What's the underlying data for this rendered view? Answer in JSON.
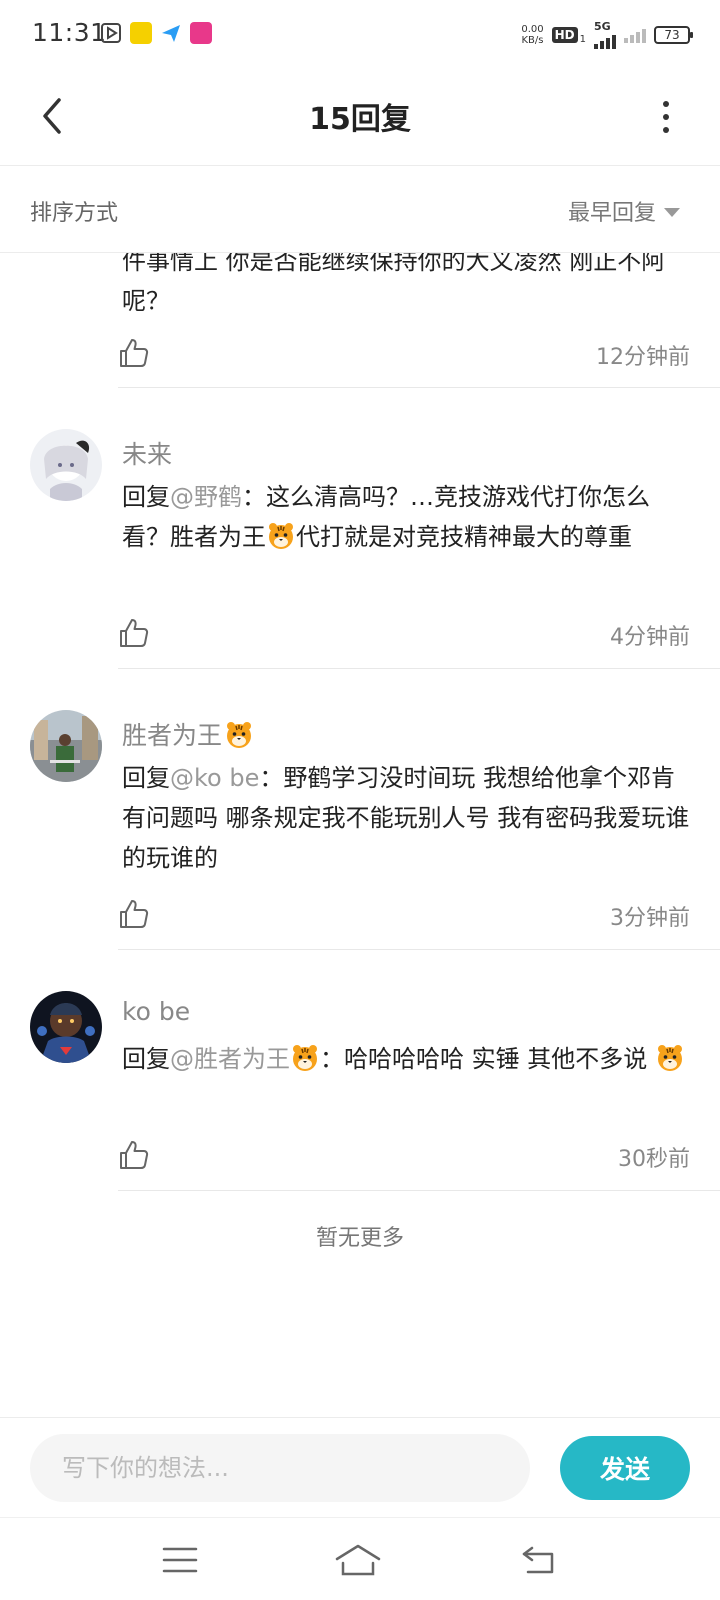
{
  "status_bar": {
    "time": "11:31",
    "net_speed_value": "0.00",
    "net_speed_unit": "KB/s",
    "hd_label": "HD",
    "hd_sub": "1",
    "network": "5G",
    "battery": "73"
  },
  "header": {
    "title": "15回复"
  },
  "sort": {
    "label": "排序方式",
    "selected": "最早回复"
  },
  "partial_comment": {
    "text": "件事情上 你是否能继续保持你的大义凌然 刚正不阿呢？",
    "time": "12分钟前"
  },
  "comments": [
    {
      "author": "未来",
      "reply_prefix": "回复",
      "mention": "@野鹤",
      "text_before": "：这么清高吗？…竞技游戏代打你怎么看？胜者为王",
      "text_after": "代打就是对竞技精神最大的尊重",
      "time": "4分钟前"
    },
    {
      "author": "胜者为王",
      "reply_prefix": "回复",
      "mention": "@ko be",
      "text": "：野鹤学习没时间玩 我想给他拿个邓肯 有问题吗 哪条规定我不能玩别人号 我有密码我爱玩谁的玩谁的",
      "time": "3分钟前"
    },
    {
      "author": "ko be",
      "reply_prefix": "回复",
      "mention": "@胜者为王",
      "text_before": "：哈哈哈哈哈 实锤 其他不多说 ",
      "time": "30秒前"
    }
  ],
  "footer": {
    "no_more": "暂无更多"
  },
  "composer": {
    "placeholder": "写下你的想法...",
    "send_label": "发送"
  },
  "colors": {
    "accent": "#26b8c6",
    "mention": "#999999",
    "name": "#888888"
  },
  "icons": [
    "back-arrow-icon",
    "more-dots-icon",
    "caret-down-icon",
    "thumbs-up-icon",
    "tiger-emoji-icon",
    "menu-icon",
    "home-icon",
    "back-nav-icon"
  ]
}
